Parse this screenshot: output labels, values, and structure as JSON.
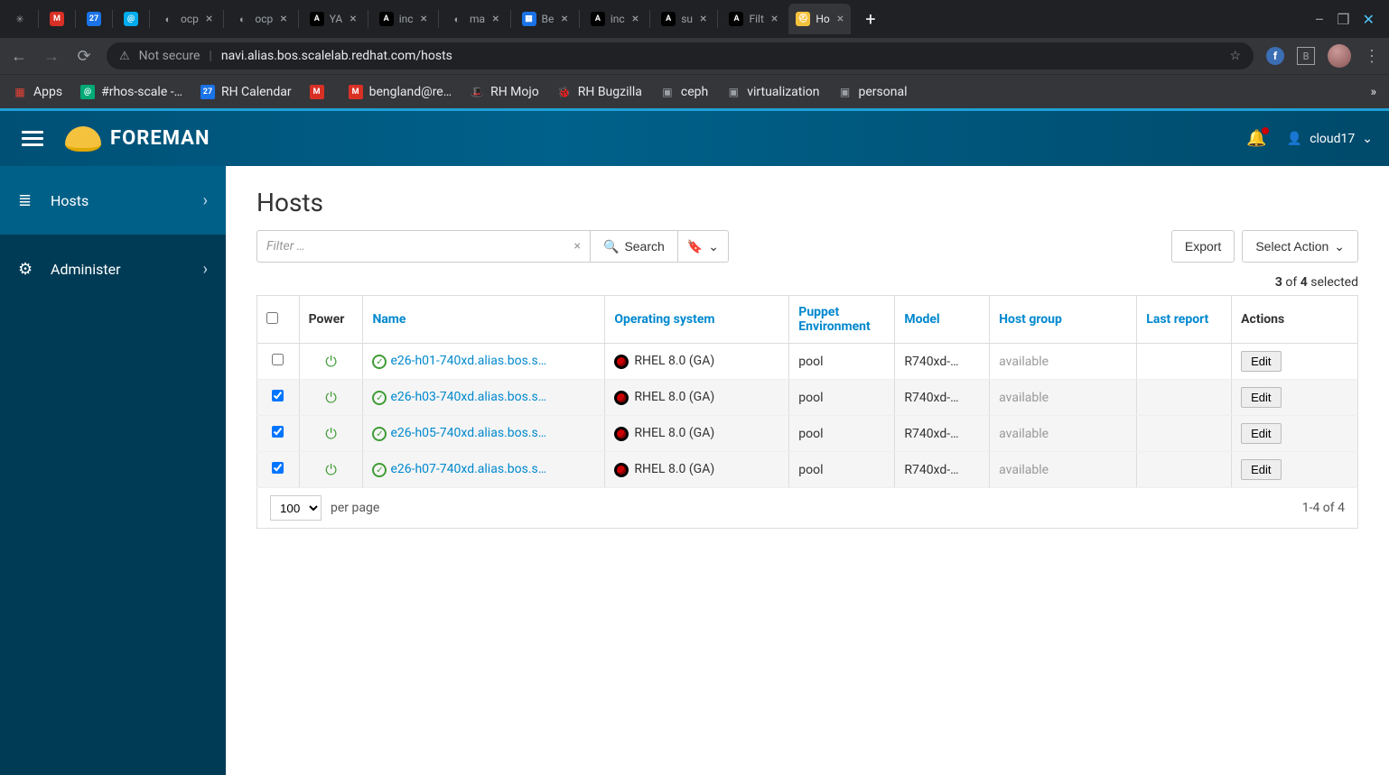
{
  "chrome": {
    "tabs": [
      {
        "icon": "✳",
        "label": ""
      },
      {
        "icon": "M",
        "label": "",
        "iconbg": "#d93025"
      },
      {
        "icon": "27",
        "label": "",
        "iconbg": "#1a73e8"
      },
      {
        "icon": "@",
        "label": "",
        "iconbg": "#00aced"
      },
      {
        "icon": "◐",
        "label": "ocp"
      },
      {
        "icon": "◐",
        "label": "ocp"
      },
      {
        "icon": "A",
        "label": "YA",
        "iconbg": "#000"
      },
      {
        "icon": "A",
        "label": "inc",
        "iconbg": "#000"
      },
      {
        "icon": "◐",
        "label": "ma"
      },
      {
        "icon": "▦",
        "label": "Be",
        "iconbg": "#1a73e8"
      },
      {
        "icon": "A",
        "label": "inc",
        "iconbg": "#000"
      },
      {
        "icon": "A",
        "label": "su",
        "iconbg": "#000"
      },
      {
        "icon": "A",
        "label": "Filt",
        "iconbg": "#000"
      },
      {
        "icon": "⛑",
        "label": "Ho",
        "active": true,
        "iconbg": "#f5c23e"
      }
    ],
    "notsecure": "Not secure",
    "url": "navi.alias.bos.scalelab.redhat.com/hosts",
    "bookmarks": [
      {
        "icon": "▦",
        "label": "Apps",
        "color": "#ea4335"
      },
      {
        "icon": "@",
        "label": "#rhos-scale -…",
        "color": "#0a7"
      },
      {
        "icon": "27",
        "label": "RH Calendar",
        "color": "#1a73e8"
      },
      {
        "icon": "M",
        "label": "",
        "color": "#d93025"
      },
      {
        "icon": "M",
        "label": "bengland@re…",
        "color": "#d93025"
      },
      {
        "icon": "🎩",
        "label": "RH Mojo",
        "color": "#c00"
      },
      {
        "icon": "🐞",
        "label": "RH Bugzilla",
        "color": "#a33"
      },
      {
        "icon": "▣",
        "label": "ceph",
        "color": "#9aa0a6"
      },
      {
        "icon": "▣",
        "label": "virtualization",
        "color": "#9aa0a6"
      },
      {
        "icon": "▣",
        "label": "personal",
        "color": "#9aa0a6"
      }
    ]
  },
  "app": {
    "brand": "FOREMAN",
    "user": "cloud17",
    "sidebar": [
      {
        "icon": "≣",
        "label": "Hosts",
        "active": true
      },
      {
        "icon": "⚙",
        "label": "Administer"
      }
    ],
    "title": "Hosts",
    "filter_placeholder": "Filter …",
    "search_label": "Search",
    "export_label": "Export",
    "select_action_label": "Select Action",
    "selected_count": "3",
    "total_count": "4",
    "selected_word": "selected",
    "of_word": "of",
    "columns": {
      "power": "Power",
      "name": "Name",
      "os": "Operating system",
      "env": "Puppet Environment",
      "model": "Model",
      "hg": "Host group",
      "rep": "Last report",
      "act": "Actions"
    },
    "rows": [
      {
        "sel": false,
        "name": "e26-h01-740xd.alias.bos.s…",
        "os": "RHEL 8.0 (GA)",
        "env": "pool",
        "model": "R740xd-…",
        "hg": "available",
        "edit": "Edit"
      },
      {
        "sel": true,
        "name": "e26-h03-740xd.alias.bos.s…",
        "os": "RHEL 8.0 (GA)",
        "env": "pool",
        "model": "R740xd-…",
        "hg": "available",
        "edit": "Edit"
      },
      {
        "sel": true,
        "name": "e26-h05-740xd.alias.bos.s…",
        "os": "RHEL 8.0 (GA)",
        "env": "pool",
        "model": "R740xd-…",
        "hg": "available",
        "edit": "Edit"
      },
      {
        "sel": true,
        "name": "e26-h07-740xd.alias.bos.s…",
        "os": "RHEL 8.0 (GA)",
        "env": "pool",
        "model": "R740xd-…",
        "hg": "available",
        "edit": "Edit"
      }
    ],
    "per_page_value": "100",
    "per_page_label": "per page",
    "range": "1-4 of 4"
  }
}
